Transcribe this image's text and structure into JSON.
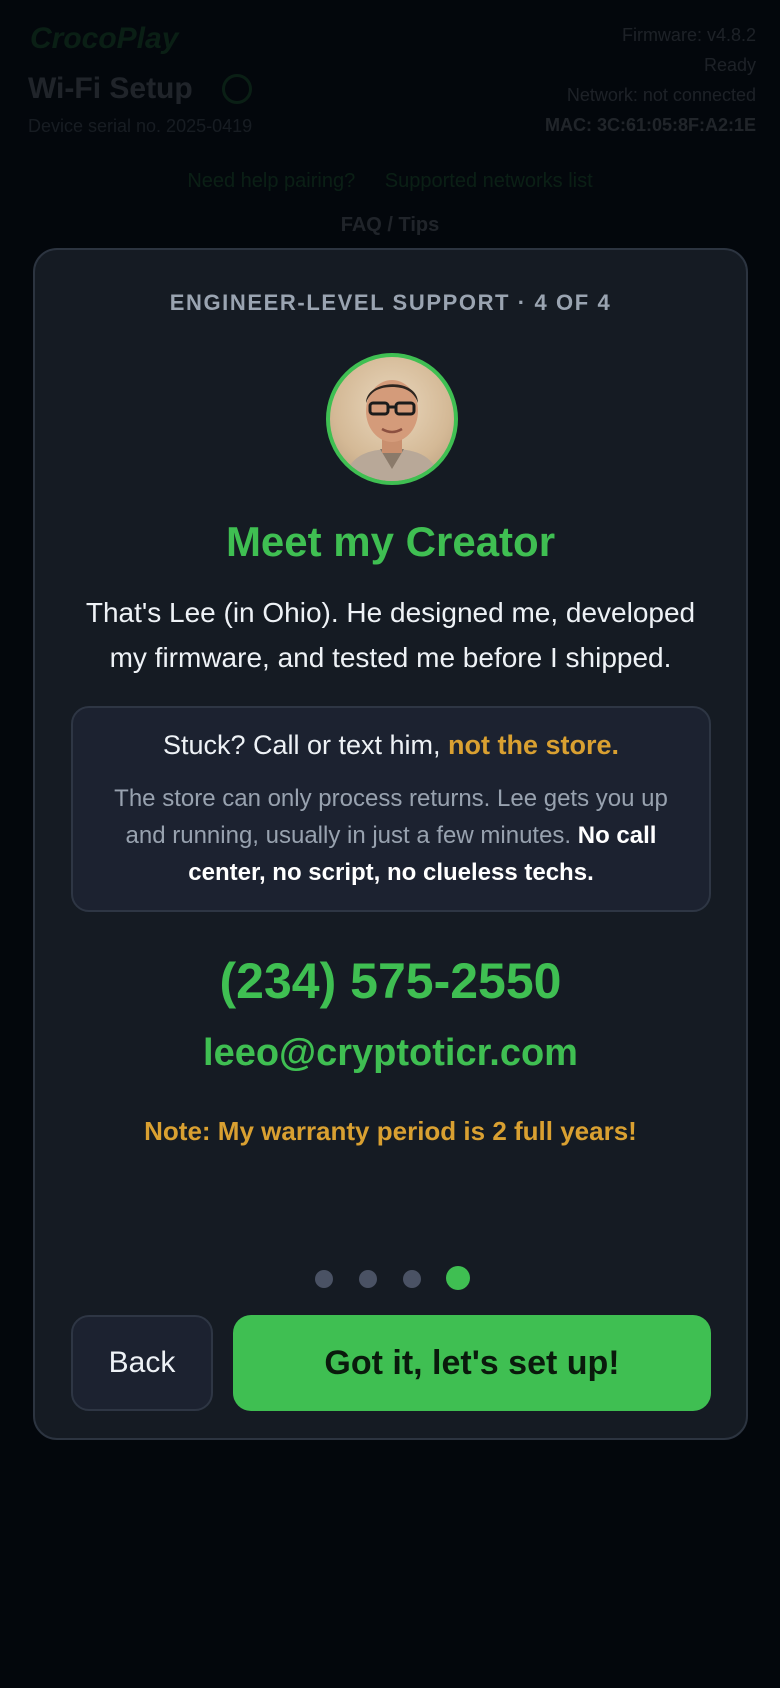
{
  "background": {
    "brand": "CrocoPlay",
    "title": "Wi-Fi Setup",
    "subtitle": "Device serial no. 2025-0419",
    "status_lines": [
      "Firmware: v4.8.2",
      "Ready",
      "Network: not connected",
      "MAC: 3C:61:05:8F:A2:1E"
    ],
    "links": [
      "Need help pairing?",
      "Supported networks list"
    ],
    "link3": "FAQ / Tips"
  },
  "modal": {
    "step_label": "ENGINEER-LEVEL SUPPORT · 4 OF 4",
    "headline": "Meet my Creator",
    "intro": "That's Lee (in Ohio). He designed me, developed my firmware, and tested me before I shipped.",
    "notice": {
      "head_plain": "Stuck? Call or text him, ",
      "head_highlight": "not the store.",
      "body_plain": "The store can only process returns. Lee gets you up and running, usually in just a few minutes. ",
      "body_bold": "No call center, no script, no clueless techs."
    },
    "phone": "(234) 575-2550",
    "email": "leeo@cryptoticr.com",
    "note": "Note: My warranty period is 2 full years!",
    "pagination": {
      "total": 4,
      "current": 4
    },
    "buttons": {
      "back": "Back",
      "next": "Got it, let's set up!"
    }
  },
  "colors": {
    "accent_green": "#3fbf52",
    "warning_amber": "#d9a031",
    "card_bg": "#151b23",
    "page_bg": "#03070c"
  }
}
